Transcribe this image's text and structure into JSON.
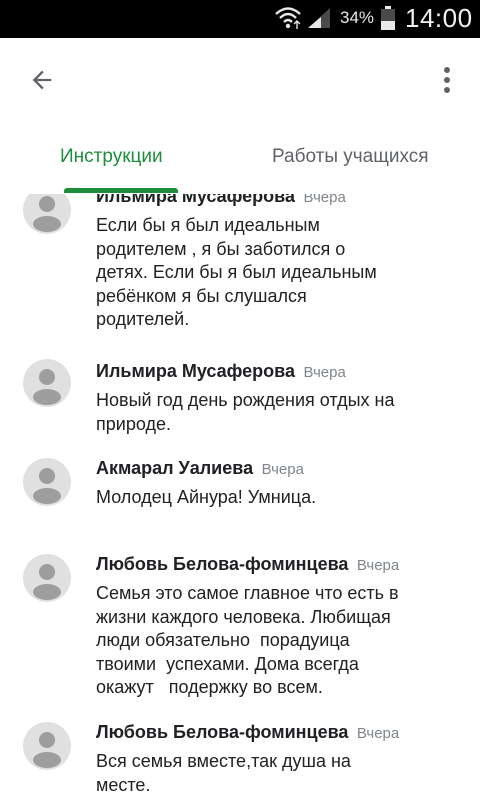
{
  "status_bar": {
    "battery_percent": "34%",
    "time": "14:00",
    "icons": [
      "wifi-icon",
      "signal-icon",
      "battery-icon"
    ]
  },
  "app_bar": {
    "back_icon": "arrow-back-icon",
    "menu_icon": "more-vert-icon"
  },
  "tabs": [
    {
      "label": "Инструкции",
      "active": true
    },
    {
      "label": "Работы учащихся",
      "active": false
    }
  ],
  "colors": {
    "accent": "#1e8e3e",
    "avatar_bg": "#e0e0e0",
    "avatar_fg": "#9e9e9e",
    "time_text": "#80868b"
  },
  "comments": [
    {
      "author": "Ильмира Мусаферова",
      "time": "Вчера",
      "text": "Если бы я был идеальным\nродителем , я бы заботился о\nдетях. Если бы я был идеальным\nребёнком я бы слушался\nродителей."
    },
    {
      "author": "Ильмира Мусаферова",
      "time": "Вчера",
      "text": "Новый год день рождения отдых на\nприроде."
    },
    {
      "author": "Акмарал Уалиева",
      "time": "Вчера",
      "text": "Молодец Айнура! Умница."
    },
    {
      "author": "Любовь Белова-фоминцева",
      "time": "Вчера",
      "text": "Семья это самое главное что есть в\nжизни каждого человека. Любищая\nлюди обязательно  порадуица\nтвоими  успехами. Дома всегда\nокажут   подержку во всем."
    },
    {
      "author": "Любовь Белова-фоминцева",
      "time": "Вчера",
      "text": "Вся семья вместе,так душа на\nместе."
    }
  ]
}
